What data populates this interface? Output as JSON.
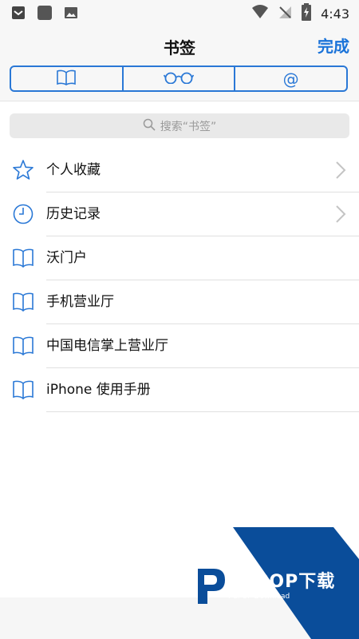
{
  "status_bar": {
    "time": "4:43",
    "left_icons": [
      "notification-icon",
      "app-square-icon",
      "image-icon"
    ],
    "right_icons": [
      "wifi-icon",
      "no-signal-icon",
      "battery-charging-icon"
    ]
  },
  "nav": {
    "title": "书签",
    "done_label": "完成",
    "segments": [
      "bookmark-icon",
      "reading-list-glasses-icon",
      "shared-links-at-icon"
    ],
    "at_symbol": "@"
  },
  "search": {
    "placeholder": "搜索“书签”"
  },
  "bookmarks": [
    {
      "label": "个人收藏",
      "icon": "star-icon",
      "has_chevron": true
    },
    {
      "label": "历史记录",
      "icon": "clock-icon",
      "has_chevron": true
    },
    {
      "label": "沃门户",
      "icon": "book-icon",
      "has_chevron": false
    },
    {
      "label": "手机营业厅",
      "icon": "book-icon",
      "has_chevron": false
    },
    {
      "label": "中国电信掌上营业厅",
      "icon": "book-icon",
      "has_chevron": false
    },
    {
      "label": "iPhone 使用手册",
      "icon": "book-icon",
      "has_chevron": false
    }
  ],
  "watermark": {
    "brand": "PCPOP下载",
    "sub": "PCPOP Download"
  },
  "colors": {
    "accent": "#1a73d9",
    "watermark_blue": "#0a4d9a"
  }
}
